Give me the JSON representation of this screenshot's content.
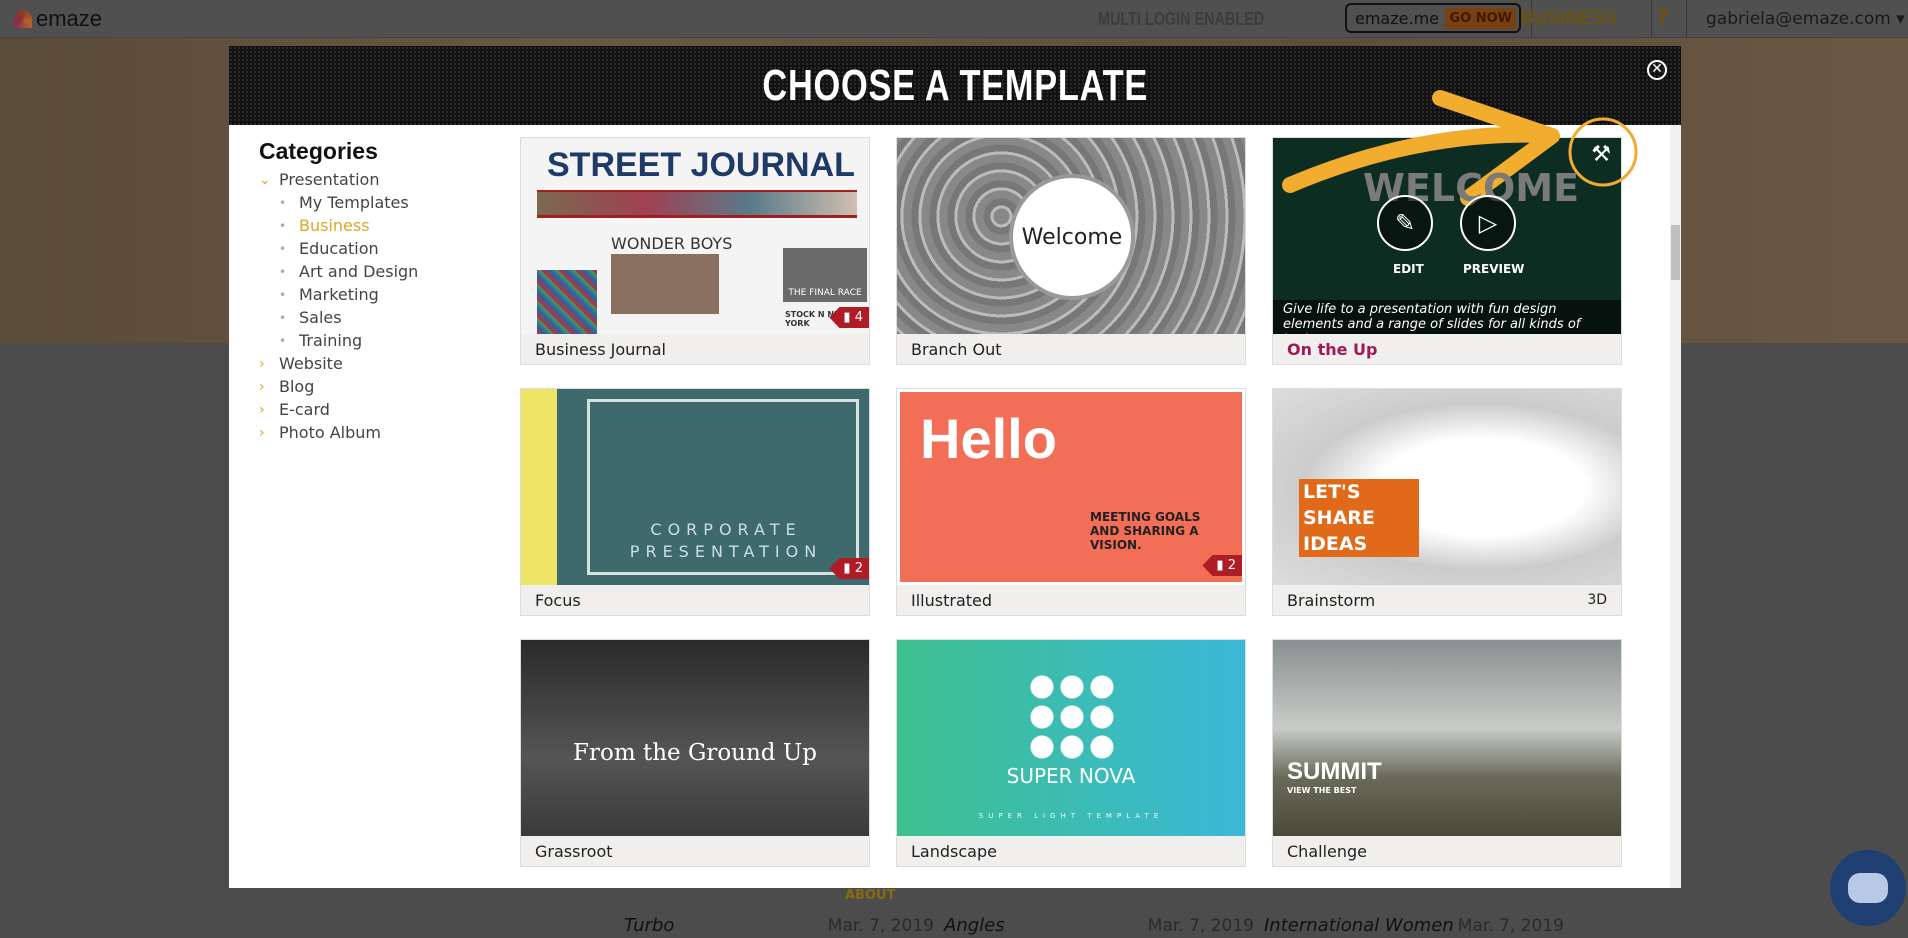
{
  "topbar": {
    "logo": "emaze",
    "multi_login": "MULTI LOGIN ENABLED",
    "emaze_me": "emaze.me",
    "go_now": "GO NOW",
    "plan": "BUSINESS",
    "help": "?",
    "user": "gabriela@emaze.com ▾"
  },
  "modal": {
    "title": "CHOOSE A TEMPLATE",
    "close": "✕"
  },
  "sidebar": {
    "heading": "Categories",
    "items": [
      {
        "label": "Presentation",
        "expanded": true,
        "children": [
          "My Templates",
          "Business",
          "Education",
          "Art and Design",
          "Marketing",
          "Sales",
          "Training"
        ],
        "active_child": "Business"
      },
      {
        "label": "Website"
      },
      {
        "label": "Blog"
      },
      {
        "label": "E-card"
      },
      {
        "label": "Photo Album"
      }
    ]
  },
  "templates": [
    {
      "name": "Business Journal",
      "badge": "4",
      "thumb_text": "STREET JOURNAL",
      "thumb_sub": "WONDER BOYS",
      "thumb_sub2": "THE FINAL RACE",
      "thumb_sub3": "STOCK N NEW YORK"
    },
    {
      "name": "Branch Out",
      "thumb_text": "Welcome"
    },
    {
      "name": "On the Up",
      "thumb_text": "WELCOME",
      "edit": "EDIT",
      "preview": "PREVIEW",
      "description": "Give life to a presentation with fun design elements and a range of slides for all kinds of text.",
      "tools_icon": "wrench-screwdriver-icon"
    },
    {
      "name": "Focus",
      "badge": "2",
      "thumb_text": "CORPORATE PRESENTATION"
    },
    {
      "name": "Illustrated",
      "badge": "2",
      "thumb_text": "Hello",
      "thumb_sub": "MEETING GOALS AND SHARING A VISION."
    },
    {
      "name": "Brainstorm",
      "tag": "3D",
      "thumb_text": "LET'S SHARE IDEAS"
    },
    {
      "name": "Grassroot",
      "thumb_text": "From the Ground Up"
    },
    {
      "name": "Landscape",
      "thumb_text": "SUPER NOVA",
      "thumb_sub": "SUPER LIGHT TEMPLATE"
    },
    {
      "name": "Challenge",
      "thumb_text": "SUMMIT",
      "thumb_sub": "VIEW THE BEST"
    }
  ],
  "background": {
    "about": "ABOUT",
    "cards": [
      {
        "title": "Turbo",
        "date": "Mar. 7, 2019"
      },
      {
        "title": "Angles",
        "date": "Mar. 7, 2019"
      },
      {
        "title": "International Women",
        "date": "Mar. 7, 2019"
      }
    ]
  },
  "colors": {
    "accent": "#e0a620",
    "badge": "#b01c25",
    "active_title": "#a0185a"
  }
}
